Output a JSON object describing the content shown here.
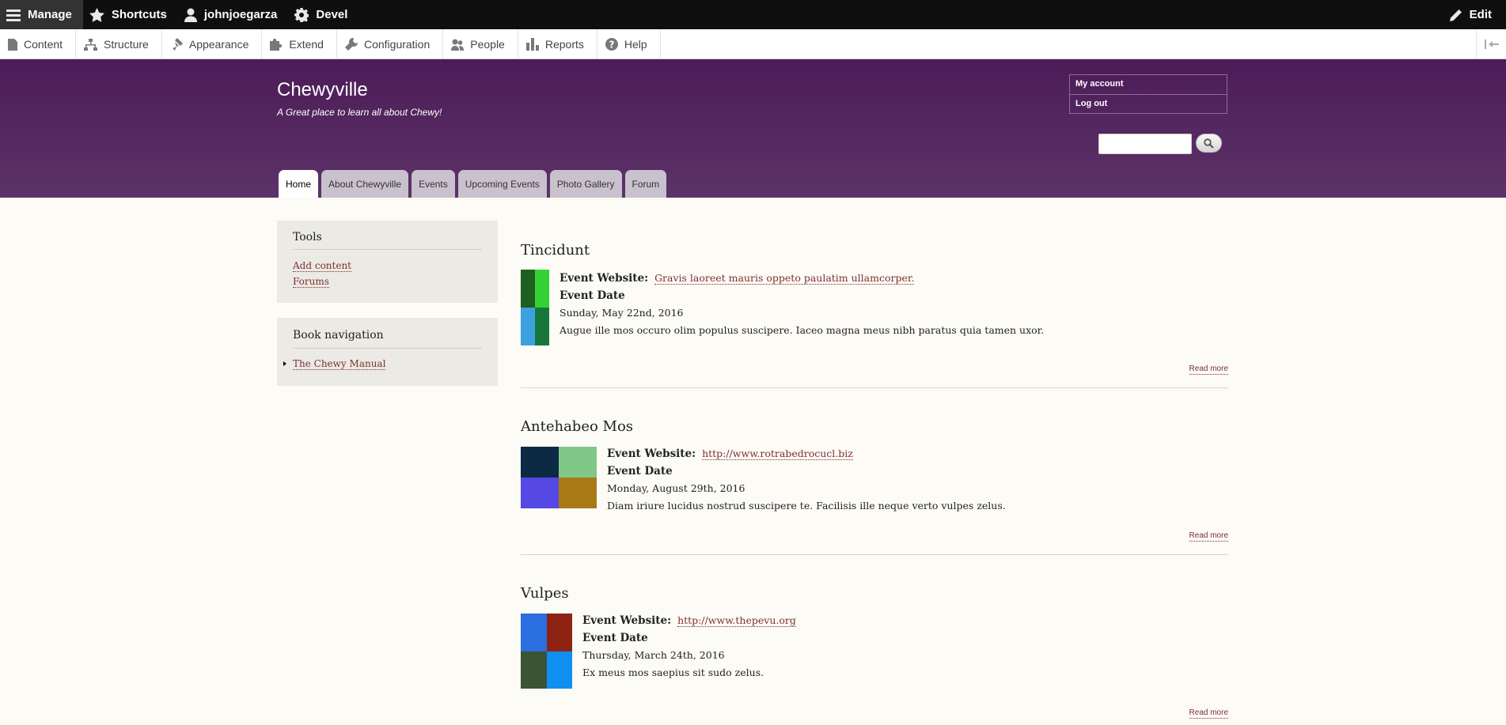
{
  "admin_toolbar": {
    "manage": "Manage",
    "shortcuts": "Shortcuts",
    "user": "johnjoegarza",
    "devel": "Devel",
    "edit": "Edit"
  },
  "admin_tray": {
    "items": [
      "Content",
      "Structure",
      "Appearance",
      "Extend",
      "Configuration",
      "People",
      "Reports",
      "Help"
    ]
  },
  "header": {
    "site_name": "Chewyville",
    "slogan": "A Great place to learn all about Chewy!",
    "account_menu": [
      "My account",
      "Log out"
    ],
    "search_value": ""
  },
  "main_nav": {
    "tabs": [
      "Home",
      "About Chewyville",
      "Events",
      "Upcoming Events",
      "Photo Gallery",
      "Forum"
    ],
    "active": "Home"
  },
  "sidebar": {
    "tools": {
      "title": "Tools",
      "links": [
        "Add content",
        "Forums"
      ]
    },
    "book_nav": {
      "title": "Book navigation",
      "links": [
        "The Chewy Manual"
      ]
    }
  },
  "articles": [
    {
      "title": "Tincidunt",
      "website_label": "Event Website:",
      "website": "Gravis laoreet mauris oppeto paulatim ullamcorper.",
      "date_label": "Event Date",
      "date": "Sunday, May 22nd, 2016",
      "body": "Augue ille mos occuro olim populus suscipere. Iaceo magna meus nibh paratus quia tamen uxor.",
      "read_more": "Read more",
      "image_colors": [
        "#1f5f1f",
        "#35d235",
        "#3da1e0",
        "#17773a"
      ]
    },
    {
      "title": "Antehabeo Mos",
      "website_label": "Event Website:",
      "website": "http://www.rotrabedrocucl.biz",
      "date_label": "Event Date",
      "date": "Monday, August 29th, 2016",
      "body": "Diam iriure lucidus nostrud suscipere te. Facilisis ille neque verto vulpes zelus.",
      "read_more": "Read more",
      "image_colors": [
        "#0d2a45",
        "#80c788",
        "#5548e5",
        "#a87a15"
      ]
    },
    {
      "title": "Vulpes",
      "website_label": "Event Website:",
      "website": "http://www.thepevu.org",
      "date_label": "Event Date",
      "date": "Thursday, March 24th, 2016",
      "body": "Ex meus mos saepius sit sudo zelus.",
      "read_more": "Read more",
      "image_colors": [
        "#2a6ee0",
        "#8e2314",
        "#3b5434",
        "#0f8ff0"
      ]
    }
  ]
}
